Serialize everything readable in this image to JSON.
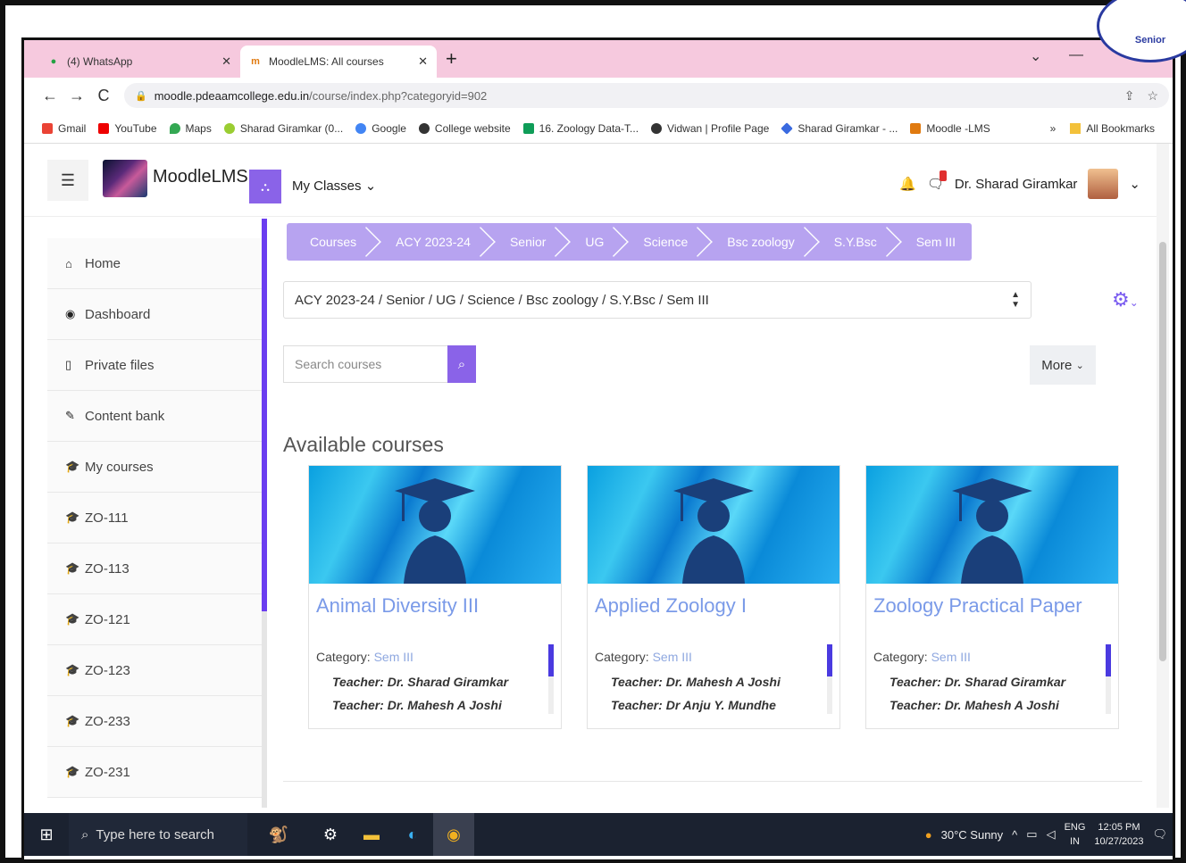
{
  "browser": {
    "tabs": [
      {
        "label": "(4) WhatsApp",
        "active": false
      },
      {
        "label": "MoodleLMS: All courses",
        "active": true
      }
    ],
    "url_host": "moodle.pdeaamcollege.edu.in",
    "url_path": "/course/index.php?categoryid=902",
    "bookmarks": [
      "Gmail",
      "YouTube",
      "Maps",
      "Sharad Giramkar (0...",
      "Google",
      "College website",
      "16. Zoology Data-T...",
      "Vidwan | Profile Page",
      "Sharad Giramkar - ...",
      "Moodle -LMS"
    ],
    "bookmarks_more": "»",
    "all_bookmarks": "All Bookmarks"
  },
  "header": {
    "site_name": "MoodleLMS",
    "my_classes": "My Classes",
    "user_name": "Dr. Sharad Giramkar"
  },
  "sidebar": {
    "items": [
      {
        "label": "Home",
        "icon": "home-icon"
      },
      {
        "label": "Dashboard",
        "icon": "dashboard-icon"
      },
      {
        "label": "Private files",
        "icon": "file-icon"
      },
      {
        "label": "Content bank",
        "icon": "brush-icon"
      },
      {
        "label": "My courses",
        "icon": "graduation-cap-icon"
      },
      {
        "label": "ZO-111",
        "icon": "graduation-cap-icon"
      },
      {
        "label": "ZO-113",
        "icon": "graduation-cap-icon"
      },
      {
        "label": "ZO-121",
        "icon": "graduation-cap-icon"
      },
      {
        "label": "ZO-123",
        "icon": "graduation-cap-icon"
      },
      {
        "label": "ZO-233",
        "icon": "graduation-cap-icon"
      },
      {
        "label": "ZO-231",
        "icon": "graduation-cap-icon"
      }
    ]
  },
  "breadcrumb": [
    "Courses",
    "ACY 2023-24",
    "Senior",
    "UG",
    "Science",
    "Bsc zoology",
    "S.Y.Bsc",
    "Sem III"
  ],
  "category_select": "ACY 2023-24 / Senior / UG / Science / Bsc zoology / S.Y.Bsc / Sem III",
  "search": {
    "placeholder": "Search courses"
  },
  "more_button": "More",
  "available_heading": "Available courses",
  "courses": [
    {
      "title": "Animal Diversity III",
      "category_label": "Category:",
      "category": "Sem III",
      "teachers": [
        "Teacher: Dr. Sharad Giramkar",
        "Teacher: Dr. Mahesh A Joshi"
      ]
    },
    {
      "title": "Applied Zoology I",
      "category_label": "Category:",
      "category": "Sem III",
      "teachers": [
        "Teacher: Dr. Mahesh A Joshi",
        "Teacher: Dr Anju Y. Mundhe"
      ]
    },
    {
      "title": "Zoology Practical Paper",
      "category_label": "Category:",
      "category": "Sem III",
      "teachers": [
        "Teacher: Dr. Sharad Giramkar",
        "Teacher: Dr. Mahesh A Joshi"
      ]
    }
  ],
  "taskbar": {
    "search_placeholder": "Type here to search",
    "weather": "30°C Sunny",
    "lang": "ENG",
    "region": "IN",
    "time": "12:05 PM",
    "date": "10/27/2023"
  },
  "stamp_text": "Senior",
  "colors": {
    "accent": "#8a63e8",
    "breadcrumb_bg": "#b7a3f0",
    "tabbar": "#f6c9de",
    "course_title": "#7a9ae8"
  }
}
